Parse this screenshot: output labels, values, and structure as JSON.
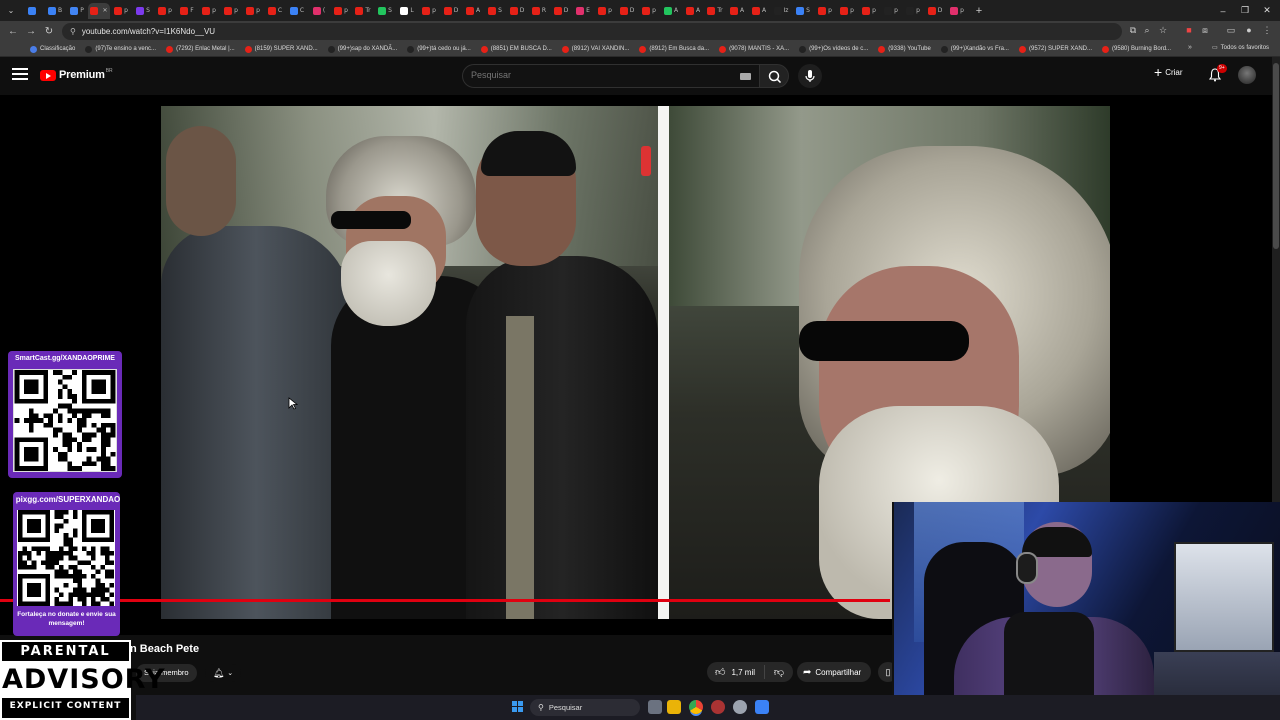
{
  "browser": {
    "url": "youtube.com/watch?v=I1K6Ndo__VU",
    "bookmarks_all": "Todos os favoritos",
    "bookmarks": [
      {
        "label": "Classificação",
        "color": "#4a7de8"
      },
      {
        "label": "(97)Te ensino a venc...",
        "color": "#222222"
      },
      {
        "label": "(7292) Enlac Metal |...",
        "color": "#e62117"
      },
      {
        "label": "(8159) SUPER XAND...",
        "color": "#e62117"
      },
      {
        "label": "(99+)sap do XANDÃ...",
        "color": "#222222"
      },
      {
        "label": "(99+)tá cedo ou já...",
        "color": "#222222"
      },
      {
        "label": "(8851) EM BUSCA D...",
        "color": "#e62117"
      },
      {
        "label": "(8912) VAI XANDIN...",
        "color": "#e62117"
      },
      {
        "label": "(8912) Em Busca da...",
        "color": "#e62117"
      },
      {
        "label": "(9078) MANTIS - XA...",
        "color": "#e62117"
      },
      {
        "label": "(99+)Os vídeos de c...",
        "color": "#222222"
      },
      {
        "label": "(9338) YouTube",
        "color": "#e62117"
      },
      {
        "label": "(99+)Xandão vs Fra...",
        "color": "#222222"
      },
      {
        "label": "(9572) SUPER XAND...",
        "color": "#e62117"
      },
      {
        "label": "(9580) Burning Bord...",
        "color": "#e62117"
      }
    ],
    "tabs": [
      {
        "label": "",
        "color": "#3b82f6"
      },
      {
        "label": "B",
        "color": "#3b82f6"
      },
      {
        "label": "P",
        "color": "#4285f4"
      },
      {
        "label": "",
        "color": "#e62117"
      },
      {
        "label": "p",
        "color": "#e62117"
      },
      {
        "label": "S",
        "color": "#7c3aed"
      },
      {
        "label": "p",
        "color": "#e62117"
      },
      {
        "label": "F",
        "color": "#e62117"
      },
      {
        "label": "p",
        "color": "#e62117"
      },
      {
        "label": "p",
        "color": "#e62117"
      },
      {
        "label": "p",
        "color": "#e62117"
      },
      {
        "label": "C",
        "color": "#e62117"
      },
      {
        "label": "C",
        "color": "#3b82f6"
      },
      {
        "label": "(",
        "color": "#e1306c"
      },
      {
        "label": "p",
        "color": "#e62117"
      },
      {
        "label": "Tr",
        "color": "#e62117"
      },
      {
        "label": "S",
        "color": "#22c55e"
      },
      {
        "label": "L",
        "color": "#ffffff"
      },
      {
        "label": "p",
        "color": "#e62117"
      },
      {
        "label": "D",
        "color": "#e62117"
      },
      {
        "label": "A",
        "color": "#e62117"
      },
      {
        "label": "S",
        "color": "#e62117"
      },
      {
        "label": "D",
        "color": "#e62117"
      },
      {
        "label": "R",
        "color": "#e62117"
      },
      {
        "label": "D",
        "color": "#e62117"
      },
      {
        "label": "E",
        "color": "#e1306c"
      },
      {
        "label": "p",
        "color": "#e62117"
      },
      {
        "label": "D",
        "color": "#e62117"
      },
      {
        "label": "p",
        "color": "#e62117"
      },
      {
        "label": "A",
        "color": "#22c55e"
      },
      {
        "label": "A",
        "color": "#e62117"
      },
      {
        "label": "Tr",
        "color": "#e62117"
      },
      {
        "label": "A",
        "color": "#e62117"
      },
      {
        "label": "A",
        "color": "#e62117"
      },
      {
        "label": "Iz",
        "color": "#222222"
      },
      {
        "label": "S",
        "color": "#3b82f6"
      },
      {
        "label": "p",
        "color": "#e62117"
      },
      {
        "label": "p",
        "color": "#e62117"
      },
      {
        "label": "p",
        "color": "#e62117"
      },
      {
        "label": "p",
        "color": "#222222"
      },
      {
        "label": "p",
        "color": "#222222"
      },
      {
        "label": "D",
        "color": "#e62117"
      },
      {
        "label": "p",
        "color": "#e1306c"
      }
    ]
  },
  "youtube": {
    "logo": "Premium",
    "region": "BR",
    "search_placeholder": "Pesquisar",
    "create_label": "Criar",
    "notif_count": "9+",
    "video_title": "n Beach Pete",
    "join_label": "Seja membro",
    "likes": "1,7 mil",
    "share_label": "Compartilhar",
    "progress_fraction": 0.7
  },
  "overlays": {
    "qr1_label": "SmartCast.gg/XANDAOPRIME",
    "qr2_label": "pixgg.com/SUPERXANDAO",
    "qr2_caption": "Fortaleça no donate e envie sua mensagem!",
    "advisory_line1": "PARENTAL",
    "advisory_line2": "ADVISORY",
    "advisory_line3": "EXPLICIT CONTENT"
  },
  "taskbar": {
    "search_label": "Pesquisar"
  },
  "colors": {
    "youtube_red": "#ff0000",
    "overlay_purple": "#6a2ab8",
    "progress_red": "#e00010"
  }
}
